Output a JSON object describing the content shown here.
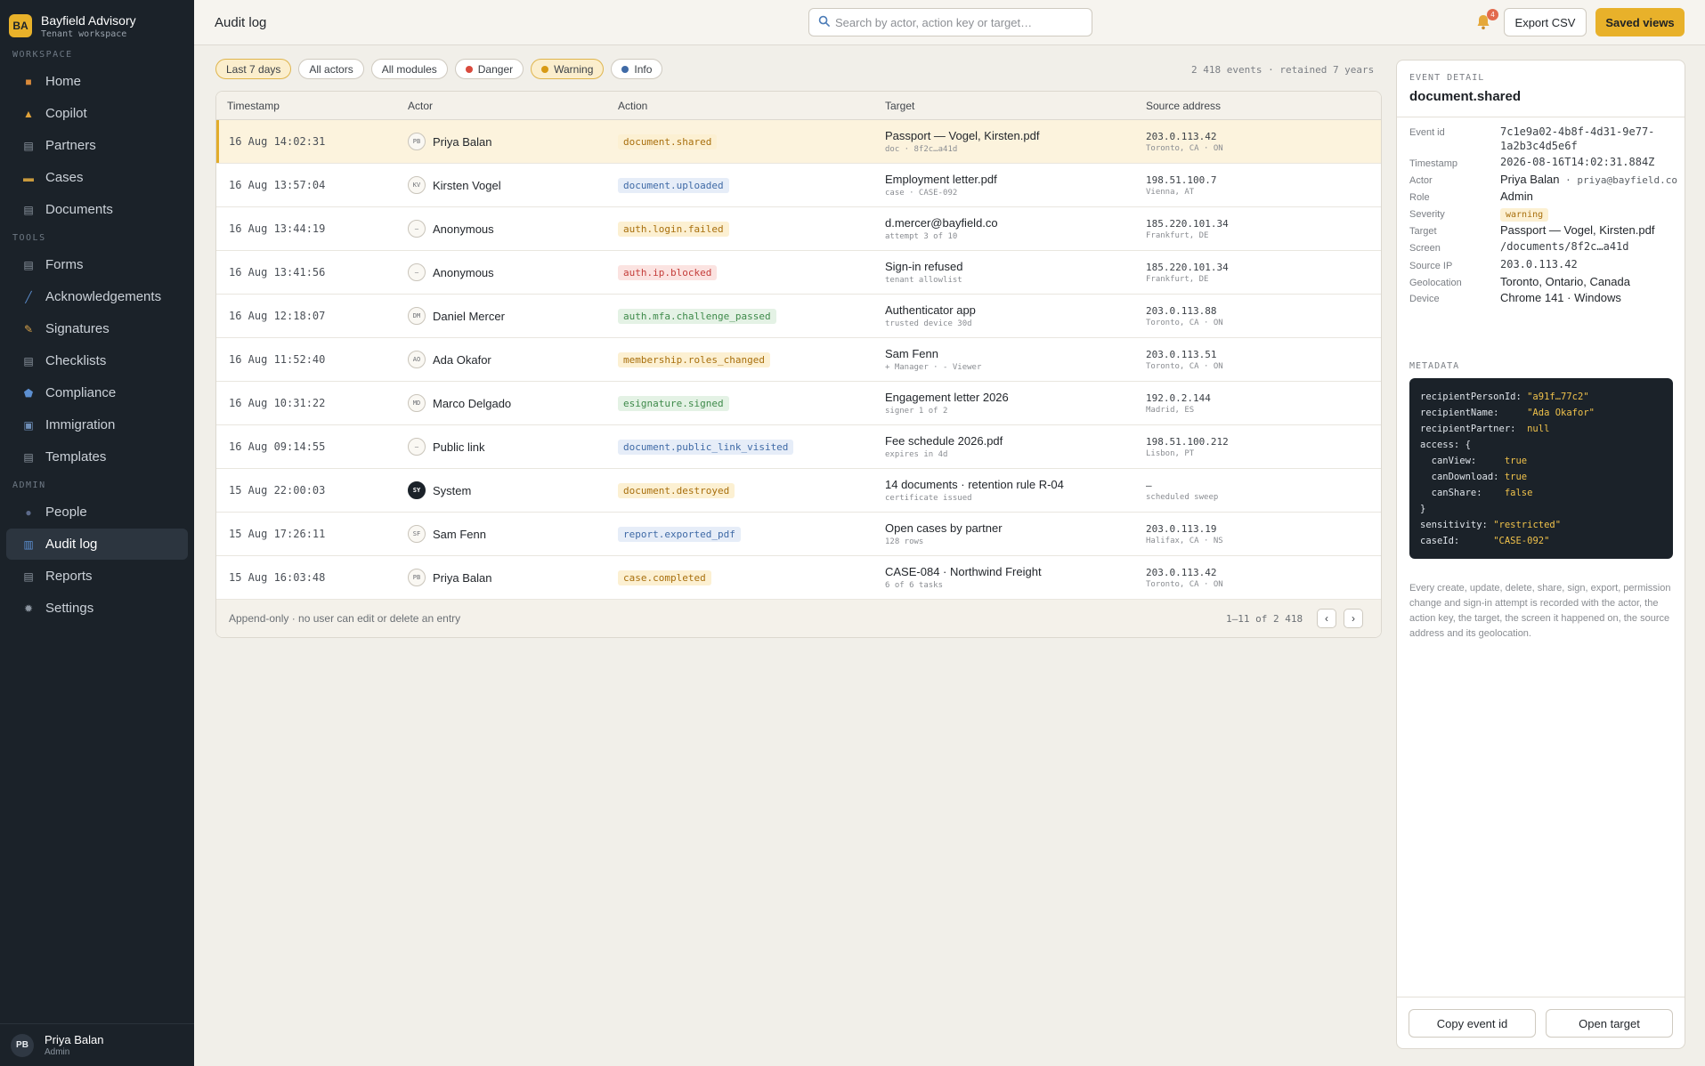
{
  "brand": {
    "badge": "BA",
    "name": "Bayfield Advisory",
    "sub": "Tenant workspace"
  },
  "sidebar": {
    "sections": [
      {
        "label": "WORKSPACE",
        "items": [
          {
            "label": "Home",
            "icon": "home-icon",
            "color": "#d98a3a"
          },
          {
            "label": "Copilot",
            "icon": "copilot-icon",
            "color": "#e0a23a"
          },
          {
            "label": "Partners",
            "icon": "partners-icon",
            "color": "#8d96a1"
          },
          {
            "label": "Cases",
            "icon": "folder-icon",
            "color": "#c99a3d"
          },
          {
            "label": "Documents",
            "icon": "document-icon",
            "color": "#8d96a1"
          }
        ]
      },
      {
        "label": "TOOLS",
        "items": [
          {
            "label": "Forms",
            "icon": "form-icon",
            "color": "#8d96a1"
          },
          {
            "label": "Acknowledgements",
            "icon": "pen-icon",
            "color": "#5c8fd1"
          },
          {
            "label": "Signatures",
            "icon": "signature-icon",
            "color": "#d9a44a"
          },
          {
            "label": "Checklists",
            "icon": "checklist-icon",
            "color": "#8d96a1"
          },
          {
            "label": "Compliance",
            "icon": "shield-icon",
            "color": "#5c8fd1"
          },
          {
            "label": "Immigration",
            "icon": "passport-icon",
            "color": "#6f8fb8"
          },
          {
            "label": "Templates",
            "icon": "template-icon",
            "color": "#8d96a1"
          }
        ]
      },
      {
        "label": "ADMIN",
        "items": [
          {
            "label": "People",
            "icon": "people-icon",
            "color": "#5c6a8a"
          },
          {
            "label": "Audit log",
            "icon": "chart-icon",
            "color": "#5c8fd1",
            "active": true
          },
          {
            "label": "Reports",
            "icon": "report-icon",
            "color": "#8d96a1"
          },
          {
            "label": "Settings",
            "icon": "gear-icon",
            "color": "#8d96a1"
          }
        ]
      }
    ],
    "user": {
      "initials": "PB",
      "name": "Priya Balan",
      "role": "Admin"
    }
  },
  "topbar": {
    "title": "Audit log",
    "search_placeholder": "Search by actor, action key or target…",
    "notifications": "4",
    "export_label": "Export CSV",
    "saved_label": "Saved views"
  },
  "filters": [
    {
      "label": "Last 7 days",
      "active": true
    },
    {
      "label": "All actors"
    },
    {
      "label": "All modules"
    },
    {
      "label": "Danger",
      "dot": "#d94a3d"
    },
    {
      "label": "Warning",
      "dot": "#d89a15",
      "active": true
    },
    {
      "label": "Info",
      "dot": "#3f6aa6"
    }
  ],
  "events_summary": "2 418 events · retained 7 years",
  "table": {
    "headers": [
      "Timestamp",
      "Actor",
      "Action",
      "Target",
      "Source address"
    ],
    "rows": [
      {
        "ts": "16 Aug 14:02:31",
        "avatar": "PB",
        "actor": "Priya Balan",
        "action": "document.shared",
        "kind": "warn",
        "target": "Passport — Vogel, Kirsten.pdf",
        "target_sub": "doc · 8f2c…a41d",
        "ip": "203.0.113.42",
        "geo": "Toronto, CA · ON",
        "selected": true
      },
      {
        "ts": "16 Aug 13:57:04",
        "avatar": "KV",
        "actor": "Kirsten Vogel",
        "action": "document.uploaded",
        "kind": "info",
        "target": "Employment letter.pdf",
        "target_sub": "case · CASE-092",
        "ip": "198.51.100.7",
        "geo": "Vienna, AT"
      },
      {
        "ts": "16 Aug 13:44:19",
        "avatar": "–",
        "actor": "Anonymous",
        "action": "auth.login.failed",
        "kind": "warn",
        "target": "d.mercer@bayfield.co",
        "target_sub": "attempt 3 of 10",
        "ip": "185.220.101.34",
        "geo": "Frankfurt, DE"
      },
      {
        "ts": "16 Aug 13:41:56",
        "avatar": "–",
        "actor": "Anonymous",
        "action": "auth.ip.blocked",
        "kind": "danger",
        "target": "Sign-in refused",
        "target_sub": "tenant allowlist",
        "ip": "185.220.101.34",
        "geo": "Frankfurt, DE"
      },
      {
        "ts": "16 Aug 12:18:07",
        "avatar": "DM",
        "actor": "Daniel Mercer",
        "action": "auth.mfa.challenge_passed",
        "kind": "success",
        "target": "Authenticator app",
        "target_sub": "trusted device 30d",
        "ip": "203.0.113.88",
        "geo": "Toronto, CA · ON"
      },
      {
        "ts": "16 Aug 11:52:40",
        "avatar": "AO",
        "actor": "Ada Okafor",
        "action": "membership.roles_changed",
        "kind": "warn",
        "target": "Sam Fenn",
        "target_sub": "+ Manager · - Viewer",
        "ip": "203.0.113.51",
        "geo": "Toronto, CA · ON"
      },
      {
        "ts": "16 Aug 10:31:22",
        "avatar": "MD",
        "actor": "Marco Delgado",
        "action": "esignature.signed",
        "kind": "success",
        "target": "Engagement letter 2026",
        "target_sub": "signer 1 of 2",
        "ip": "192.0.2.144",
        "geo": "Madrid, ES"
      },
      {
        "ts": "16 Aug 09:14:55",
        "avatar": "–",
        "actor": "Public link",
        "action": "document.public_link_visited",
        "kind": "info",
        "target": "Fee schedule 2026.pdf",
        "target_sub": "expires in 4d",
        "ip": "198.51.100.212",
        "geo": "Lisbon, PT"
      },
      {
        "ts": "15 Aug 22:00:03",
        "avatar": "SY",
        "actor": "System",
        "action": "document.destroyed",
        "kind": "warn",
        "target": "14 documents · retention rule R-04",
        "target_sub": "certificate issued",
        "ip": "—",
        "geo": "scheduled sweep",
        "dark": true
      },
      {
        "ts": "15 Aug 17:26:11",
        "avatar": "SF",
        "actor": "Sam Fenn",
        "action": "report.exported_pdf",
        "kind": "info",
        "target": "Open cases by partner",
        "target_sub": "128 rows",
        "ip": "203.0.113.19",
        "geo": "Halifax, CA · NS"
      },
      {
        "ts": "15 Aug 16:03:48",
        "avatar": "PB",
        "actor": "Priya Balan",
        "action": "case.completed",
        "kind": "warn",
        "target": "CASE-084 · Northwind Freight",
        "target_sub": "6 of 6 tasks",
        "ip": "203.0.113.42",
        "geo": "Toronto, CA · ON"
      }
    ],
    "footer_note": "Append-only · no user can edit or delete an entry",
    "pager": "1–11 of 2 418"
  },
  "detail": {
    "label": "EVENT DETAIL",
    "title": "document.shared",
    "fields": [
      {
        "key": "Event id",
        "value": "7c1e9a02-4b8f-4d31-9e77-1a2b3c4d5e6f",
        "mono": true
      },
      {
        "key": "Timestamp",
        "value": "2026-08-16T14:02:31.884Z",
        "mono": true
      },
      {
        "key": "Actor",
        "value": "Priya Balan",
        "extra": "priya@bayfield.co"
      },
      {
        "key": "Role",
        "value": "Admin"
      },
      {
        "key": "Severity",
        "value": "warning",
        "tag": true
      },
      {
        "key": "Target",
        "value": "Passport — Vogel, Kirsten.pdf"
      },
      {
        "key": "Screen",
        "value": "/documents/8f2c…a41d",
        "mono": true
      },
      {
        "key": "Source IP",
        "value": "203.0.113.42",
        "mono": true
      },
      {
        "key": "Geolocation",
        "value": "Toronto, Ontario, Canada"
      },
      {
        "key": "Device",
        "value": "Chrome 141 · Windows"
      }
    ],
    "metadata_label": "METADATA",
    "metadata_lines": [
      [
        "recipientPersonId: ",
        "\"a91f…77c2\""
      ],
      [
        "recipientName:     ",
        "\"Ada Okafor\""
      ],
      [
        "recipientPartner:  ",
        "null"
      ],
      [
        "access: {",
        ""
      ],
      [
        "  canView:     ",
        "true"
      ],
      [
        "  canDownload: ",
        "true"
      ],
      [
        "  canShare:    ",
        "false"
      ],
      [
        "}",
        ""
      ],
      [
        "sensitivity: ",
        "\"restricted\""
      ],
      [
        "caseId:      ",
        "\"CASE-092\""
      ]
    ],
    "note": "Every create, update, delete, share, sign, export, permission change and sign-in attempt is recorded with the actor, the action key, the target, the screen it happened on, the source address and its geolocation.",
    "copy_label": "Copy event id",
    "open_label": "Open target"
  }
}
